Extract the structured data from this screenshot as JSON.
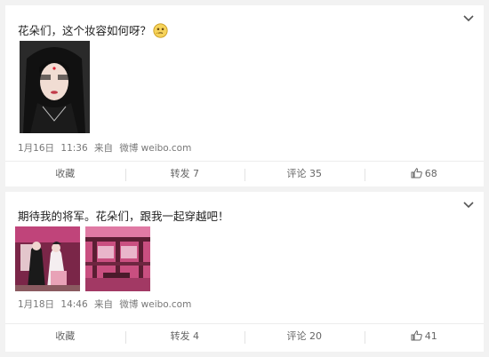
{
  "posts": [
    {
      "text": "花朵们，这个妆容如何呀？",
      "emoji": "thinking-face-emoji",
      "date": "1月16日",
      "time": "11:36",
      "source_prefix": "来自",
      "source": "微博 weibo.com",
      "actions": {
        "favorite": "收藏",
        "repost": "转发 7",
        "comment": "评论 35",
        "like": "68"
      },
      "images": [
        "portrait-photo"
      ]
    },
    {
      "text": "期待我的将军。花朵们，跟我一起穿越吧！",
      "date": "1月18日",
      "time": "14:46",
      "source_prefix": "来自",
      "source": "微博 weibo.com",
      "actions": {
        "favorite": "收藏",
        "repost": "转发 4",
        "comment": "评论 20",
        "like": "41"
      },
      "images": [
        "group-photo",
        "hall-photo"
      ]
    }
  ],
  "icons": {
    "menu": "chevron-down-icon",
    "like": "thumbs-up-icon"
  },
  "colors": {
    "background": "#f2f2f2",
    "card": "#ffffff",
    "meta_text": "#777777",
    "divider": "#ececec"
  }
}
